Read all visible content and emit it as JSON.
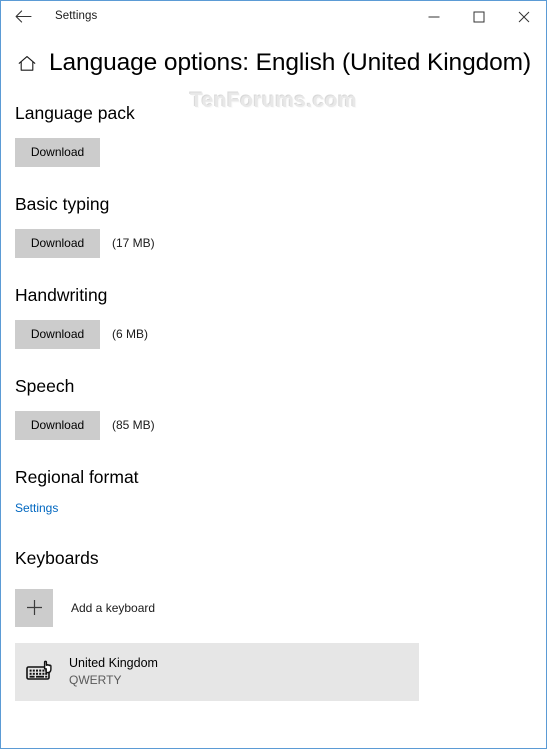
{
  "window": {
    "app_title": "Settings",
    "back_icon": "back-arrow-icon",
    "minimize_icon": "minimize-icon",
    "maximize_icon": "maximize-icon",
    "close_icon": "close-icon",
    "border_color": "#5b9bd5"
  },
  "header": {
    "home_icon": "home-icon",
    "title": "Language options: English (United Kingdom)"
  },
  "watermark": {
    "text": "TenForums.com",
    "color": "#e8e8e8"
  },
  "sections": {
    "language_pack": {
      "title": "Language pack",
      "button_label": "Download",
      "size": ""
    },
    "basic_typing": {
      "title": "Basic typing",
      "button_label": "Download",
      "size": "(17 MB)"
    },
    "handwriting": {
      "title": "Handwriting",
      "button_label": "Download",
      "size": "(6 MB)"
    },
    "speech": {
      "title": "Speech",
      "button_label": "Download",
      "size": "(85 MB)"
    },
    "regional_format": {
      "title": "Regional format",
      "link_label": "Settings",
      "link_color": "#0067c0"
    },
    "keyboards": {
      "title": "Keyboards",
      "add_label": "Add a keyboard",
      "add_icon": "plus-icon",
      "items": [
        {
          "icon": "keyboard-icon",
          "name": "United Kingdom",
          "layout": "QWERTY"
        }
      ]
    }
  }
}
